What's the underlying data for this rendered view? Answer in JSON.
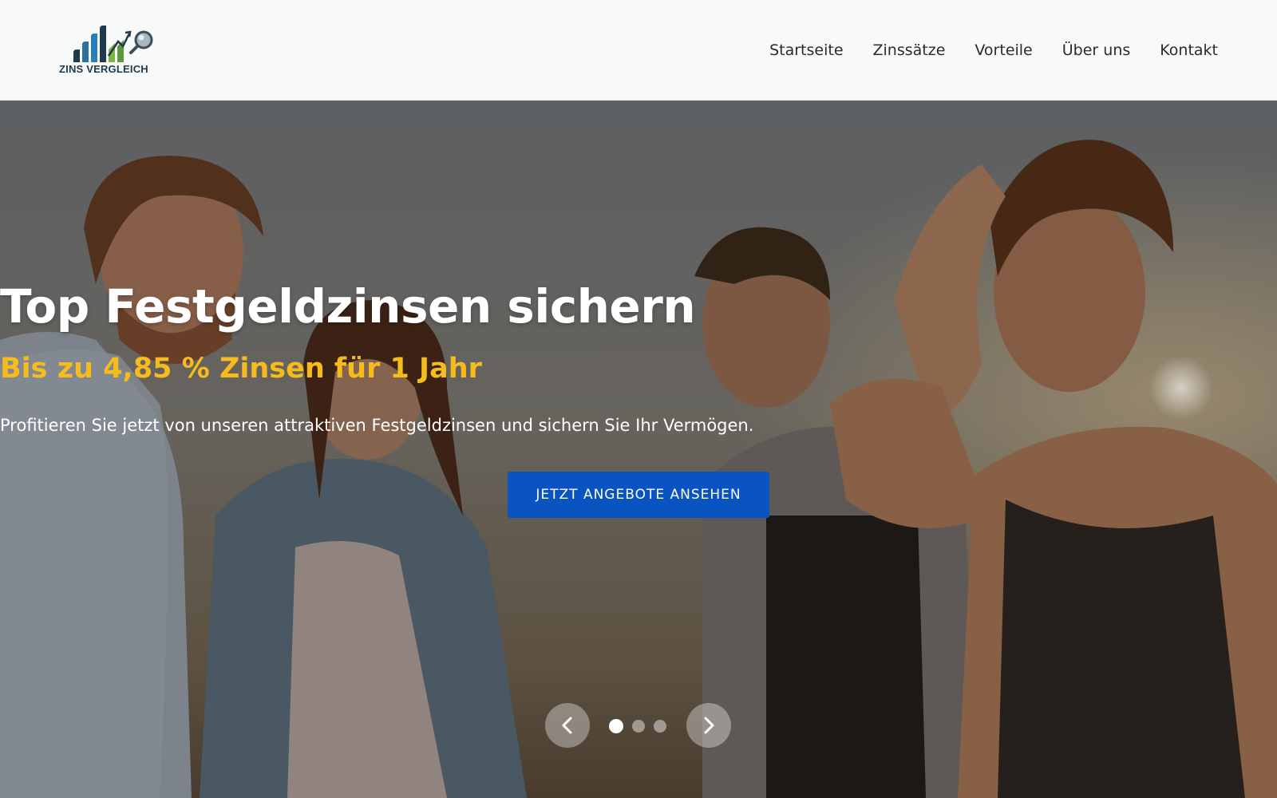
{
  "brand": {
    "name": "ZINS VERGLEICH",
    "colors": {
      "bars_dark": "#1f3a4d",
      "bars_blue": "#2b7fb8",
      "bars_green": "#7ab648"
    }
  },
  "nav": {
    "items": [
      {
        "label": "Startseite"
      },
      {
        "label": "Zinssätze"
      },
      {
        "label": "Vorteile"
      },
      {
        "label": "Über uns"
      },
      {
        "label": "Kontakt"
      }
    ]
  },
  "hero": {
    "title": "Top Festgeldzinsen sichern",
    "subtitle": "Bis zu 4,85 % Zinsen für 1 Jahr",
    "text": "Profitieren Sie jetzt von unseren attraktiven Festgeldzinsen und sichern Sie Ihr Vermögen.",
    "cta_label": "JETZT ANGEBOTE ANSEHEN",
    "accent_color": "#f6bb1c",
    "cta_color": "#0a54c2",
    "image": "photo of four smiling young people outdoors in sunlight"
  },
  "slider": {
    "prev_icon": "chevron-left-icon",
    "next_icon": "chevron-right-icon",
    "slides": 3,
    "active_slide": 1
  }
}
